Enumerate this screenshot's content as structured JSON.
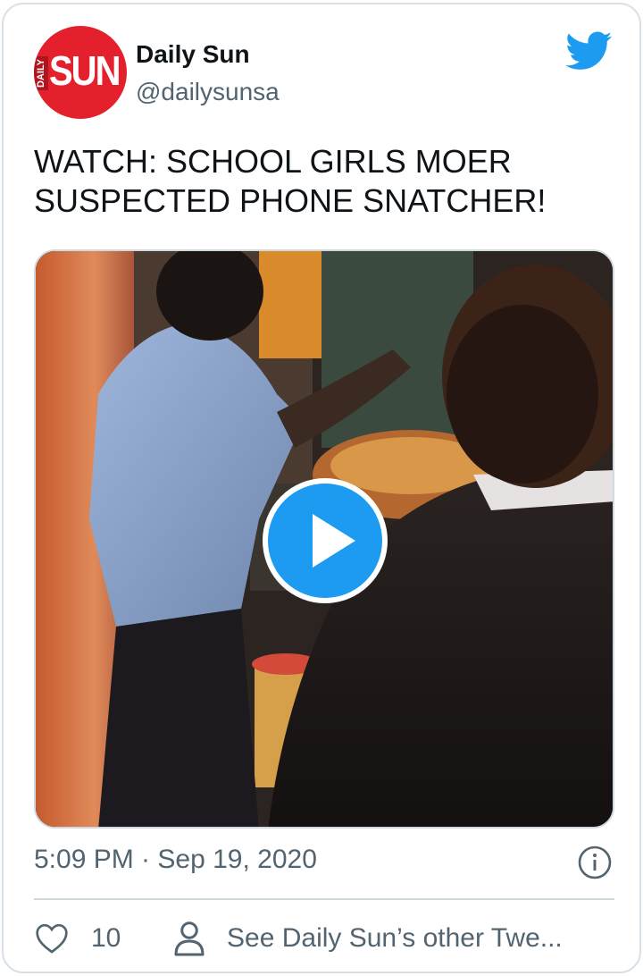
{
  "account": {
    "display_name": "Daily Sun",
    "handle": "@dailysunsa",
    "avatar_text_small": "DAILY",
    "avatar_text_large": "SUN",
    "avatar_color": "#e3202c"
  },
  "brand_icon": "twitter-bird-icon",
  "brand_color": "#1d9bf0",
  "tweet": {
    "text": "WATCH: SCHOOL GIRLS MOER SUSPECTED PHONE SNATCHER!",
    "timestamp": "5:09 PM · Sep 19, 2020"
  },
  "media": {
    "type": "video",
    "play_icon": "play-icon"
  },
  "actions": {
    "like_icon": "heart-icon",
    "like_count": "10",
    "profile_icon": "person-icon",
    "see_others_label": "See Daily Sun’s other Twe..."
  },
  "info_icon": "info-icon"
}
